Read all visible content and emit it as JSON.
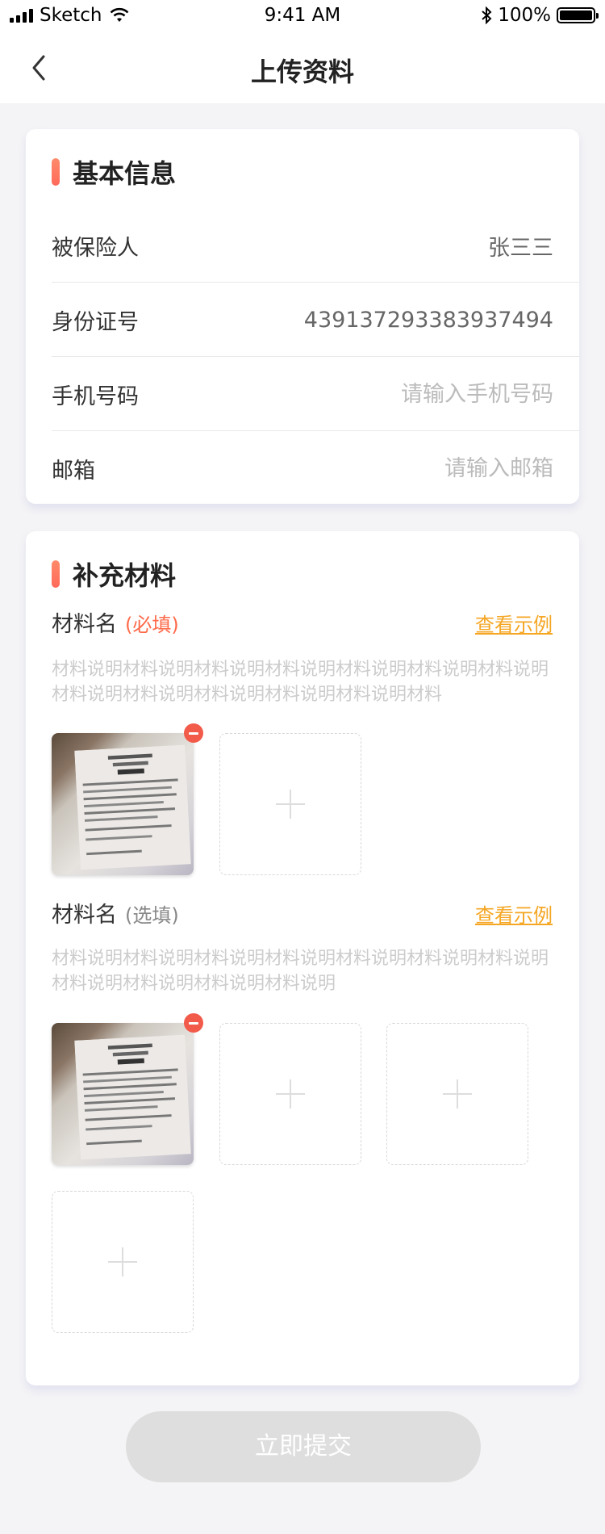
{
  "status_bar": {
    "carrier": "Sketch",
    "time": "9:41 AM",
    "battery": "100%"
  },
  "nav": {
    "title": "上传资料",
    "back_icon": "chevron-left-icon"
  },
  "basic_info": {
    "title": "基本信息",
    "rows": [
      {
        "label": "被保险人",
        "value": "张三三"
      },
      {
        "label": "身份证号",
        "value": "439137293383937494"
      },
      {
        "label": "手机号码",
        "value": "",
        "placeholder": "请输入手机号码"
      },
      {
        "label": "邮箱",
        "value": "",
        "placeholder": "请输入邮箱"
      }
    ]
  },
  "materials": {
    "title": "补充材料",
    "items": [
      {
        "name": "材料名",
        "tag": "(必填)",
        "example_link": "查看示例",
        "description": "材料说明材料说明材料说明材料说明材料说明材料说明材料说明材料说明材料说明材料说明材料说明材料说明材料"
      },
      {
        "name": "材料名",
        "tag": "(选填)",
        "example_link": "查看示例",
        "description": "材料说明材料说明材料说明材料说明材料说明材料说明材料说明材料说明材料说明材料说明材料说明"
      }
    ]
  },
  "submit_label": "立即提交",
  "colors": {
    "accent": "#ff6a5a",
    "link": "#f5a623",
    "remove": "#f25a4a",
    "disabled_button": "#dedede"
  }
}
